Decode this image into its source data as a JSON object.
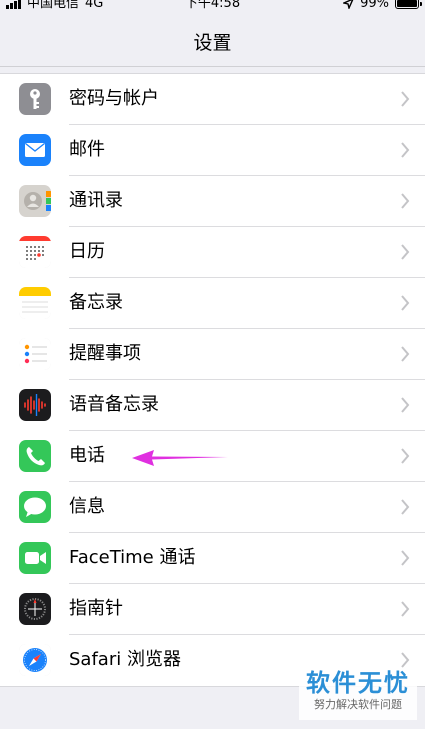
{
  "status_bar": {
    "carrier": "中国电信",
    "network": "4G",
    "time": "下午4:58",
    "battery": "99%",
    "battery_level": 0.99
  },
  "nav": {
    "title": "设置"
  },
  "settings": [
    {
      "label": "密码与帐户",
      "icon": "key-icon",
      "color": "#8e8e93"
    },
    {
      "label": "邮件",
      "icon": "mail-icon",
      "color": "#1a82fb"
    },
    {
      "label": "通讯录",
      "icon": "contacts-icon",
      "color": "#b5b1ab"
    },
    {
      "label": "日历",
      "icon": "calendar-icon",
      "color": "#ffffff"
    },
    {
      "label": "备忘录",
      "icon": "notes-icon",
      "color": "#ffcc00"
    },
    {
      "label": "提醒事项",
      "icon": "reminders-icon",
      "color": "#ffffff"
    },
    {
      "label": "语音备忘录",
      "icon": "voice-memos-icon",
      "color": "#1c1c1e"
    },
    {
      "label": "电话",
      "icon": "phone-icon",
      "color": "#34c759"
    },
    {
      "label": "信息",
      "icon": "messages-icon",
      "color": "#34c759"
    },
    {
      "label": "FaceTime 通话",
      "icon": "facetime-icon",
      "color": "#34c759"
    },
    {
      "label": "指南针",
      "icon": "compass-icon",
      "color": "#1c1c1e"
    },
    {
      "label": "Safari 浏览器",
      "icon": "safari-icon",
      "color": "#ffffff"
    }
  ],
  "annotation": {
    "arrow_color": "#e030e0"
  },
  "watermark": {
    "title": "软件无忧",
    "subtitle": "努力解决软件问题"
  }
}
